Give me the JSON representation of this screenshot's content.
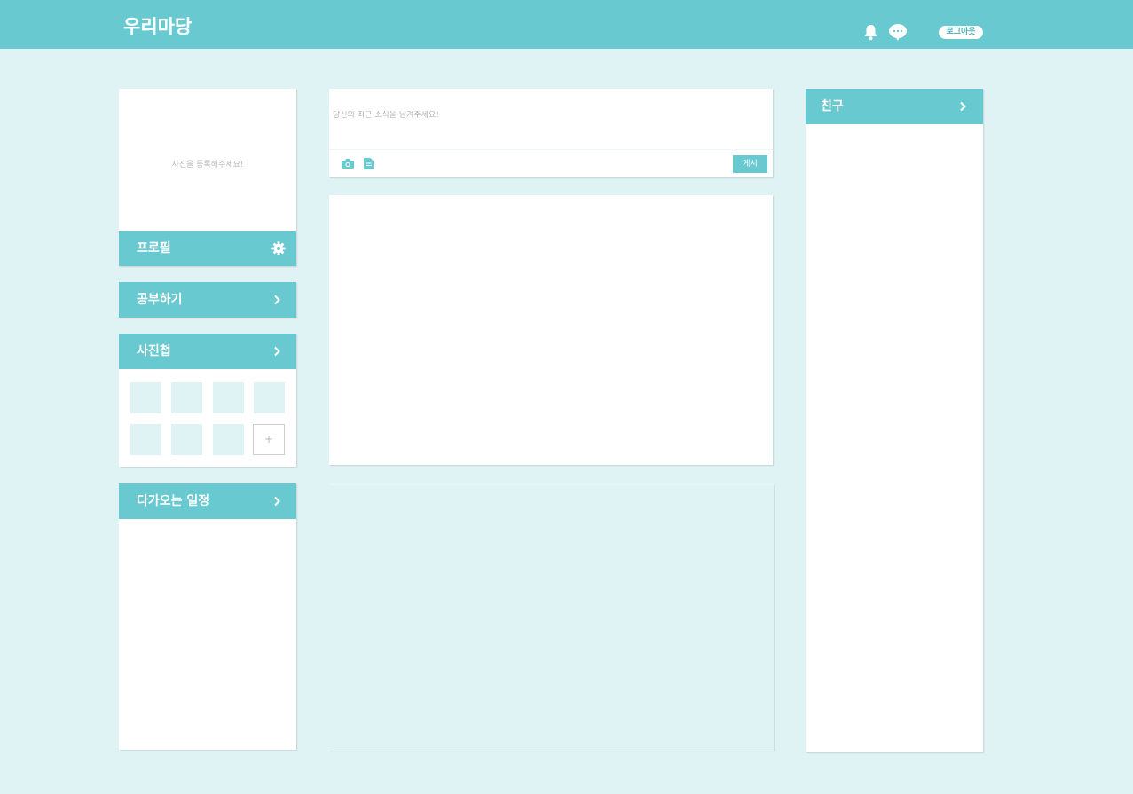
{
  "header": {
    "logo": "우리마당",
    "logout_label": "로그아웃"
  },
  "profile": {
    "photo_hint": "사진을 등록해주세요!",
    "title": "프로필"
  },
  "study": {
    "title": "공부하기"
  },
  "album": {
    "title": "사진첩",
    "add_label": "+"
  },
  "schedule": {
    "title": "다가오는 일정"
  },
  "composer": {
    "placeholder": "당신의 최근 소식을 남겨주세요!",
    "post_label": "게시"
  },
  "friends": {
    "title": "친구"
  },
  "colors": {
    "accent": "#68cad0",
    "background": "#dff2f4",
    "panel": "#ffffff"
  }
}
